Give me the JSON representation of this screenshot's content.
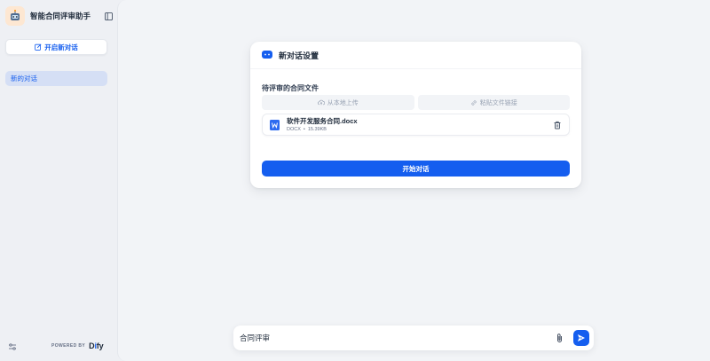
{
  "app": {
    "title": "智能合同评审助手",
    "logo_icon": "robot-mascot-icon"
  },
  "sidebar": {
    "new_chat_label": "开启新对话",
    "conversations": [
      {
        "label": "新的对话",
        "active": true
      }
    ],
    "powered_by": "POWERED BY",
    "brand": {
      "name": "Dify"
    }
  },
  "setup_card": {
    "title": "新对话设置",
    "field_label": "待评审的合同文件",
    "upload_local_label": "从本地上传",
    "paste_link_label": "粘贴文件链接",
    "files": [
      {
        "name": "软件开发服务合同.docx",
        "type": "DOCX",
        "size": "15.39KB"
      }
    ],
    "start_label": "开始对话"
  },
  "chat_input": {
    "value": "合同评审"
  },
  "colors": {
    "accent": "#155eef",
    "sidebar_bg": "#eef0f4",
    "active_item_bg": "#d5dff5"
  }
}
